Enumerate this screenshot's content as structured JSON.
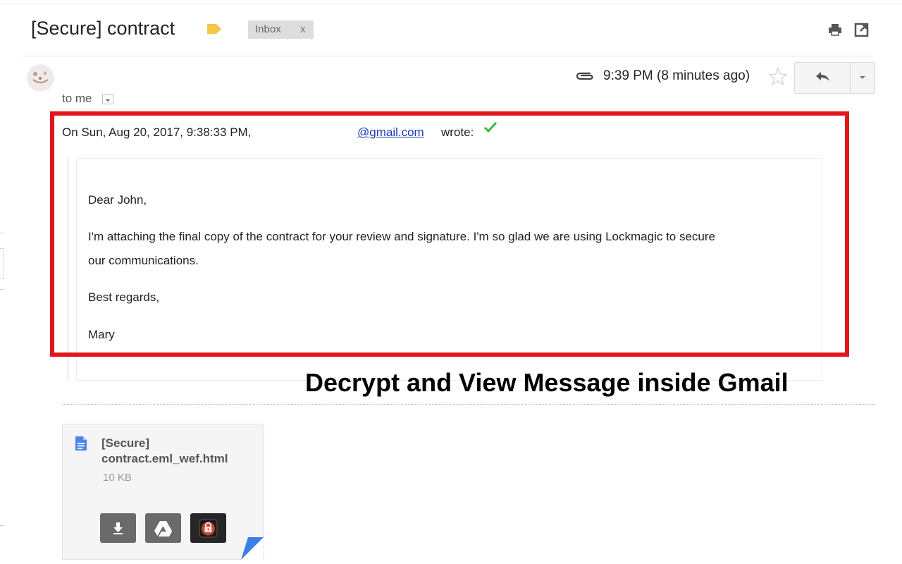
{
  "header": {
    "subject": "[Secure] contract",
    "label_chip": "Inbox",
    "label_remove": "x"
  },
  "message": {
    "recipient": "to me",
    "timestamp": "9:39 PM (8 minutes ago)",
    "quote_header_prefix": "On Sun, Aug 20, 2017, 9:38:33 PM,",
    "quote_header_email": "@gmail.com",
    "quote_header_suffix": "wrote:",
    "body": {
      "greeting": "Dear John,",
      "paragraph_line1": "I'm attaching the final copy of the contract for your review and signature. I'm so glad we are using Lockmagic to secure",
      "paragraph_line2": "our communications.",
      "closing": "Best regards,",
      "signature": "Mary"
    }
  },
  "caption": "Decrypt and View Message inside Gmail",
  "attachment": {
    "name_line1": "[Secure]",
    "name_line2": "contract.eml_wef.html",
    "size": "10 KB",
    "icons": [
      "download-icon",
      "drive-icon",
      "lockmagic-icon"
    ]
  },
  "colors": {
    "highlight": "#e3141b",
    "link": "#1a3cb8",
    "important_marker": "#f6c745",
    "verified_check": "#3cb83c",
    "doc_icon": "#4a86e8"
  }
}
